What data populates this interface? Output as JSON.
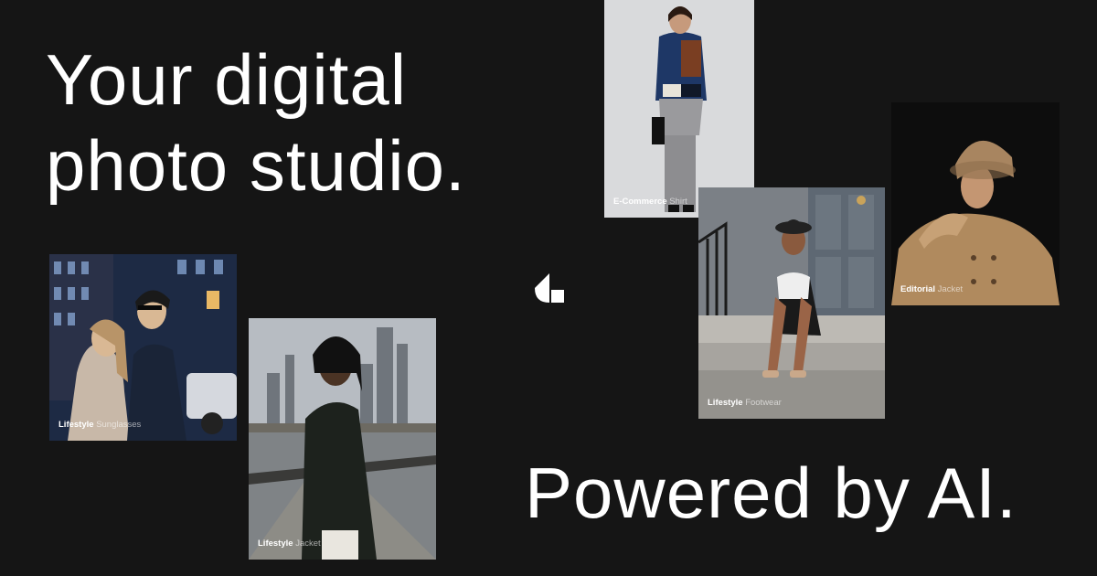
{
  "headline": {
    "line1": "Your digital",
    "line2": "photo studio."
  },
  "tagline": "Powered by AI.",
  "logo": {
    "icon": "brand-logo-icon",
    "color": "#ffffff"
  },
  "colors": {
    "background": "#151515",
    "text": "#ffffff"
  },
  "photos": [
    {
      "category": "Lifestyle",
      "item": "Sunglasses"
    },
    {
      "category": "Lifestyle",
      "item": "Jacket"
    },
    {
      "category": "E-Commerce",
      "item": "Shirt"
    },
    {
      "category": "Lifestyle",
      "item": "Footwear"
    },
    {
      "category": "Editorial",
      "item": "Jacket"
    }
  ]
}
